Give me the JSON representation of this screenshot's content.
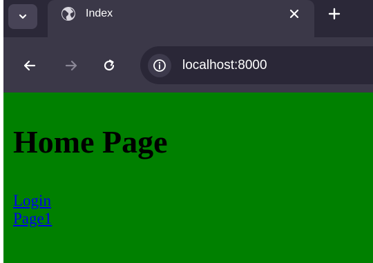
{
  "browser": {
    "tab": {
      "title": "Index",
      "favicon": "globe-icon"
    },
    "tabstrip_icons": {
      "dropdown": "chevron-down-icon",
      "close": "close-icon",
      "new_tab": "plus-icon"
    },
    "toolbar": {
      "back": "arrow-left-icon",
      "forward": "arrow-right-icon",
      "reload": "reload-icon",
      "site_info": "info-icon",
      "url": "localhost:8000"
    },
    "colors": {
      "tabstrip": "#2b2838",
      "toolbar": "#3b3848",
      "omnibox": "#2a2737"
    }
  },
  "page": {
    "background": "#008000",
    "heading": "Home Page",
    "links": [
      {
        "label": "Login"
      },
      {
        "label": "Page1"
      }
    ],
    "link_color": "#0000ee"
  }
}
